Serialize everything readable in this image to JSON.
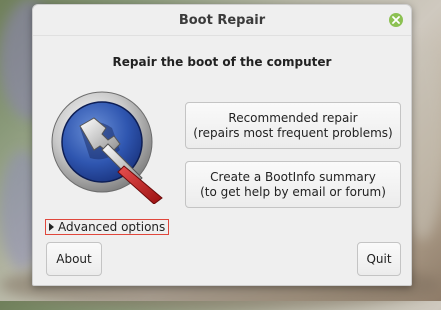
{
  "window": {
    "title": "Boot Repair"
  },
  "main": {
    "heading": "Repair the boot of the computer",
    "recommended_repair": {
      "line1": "Recommended repair",
      "line2": "(repairs most frequent problems)"
    },
    "bootinfo_summary": {
      "line1": "Create a BootInfo summary",
      "line2": "(to get help by email or forum)"
    },
    "advanced_options_label": "Advanced options"
  },
  "footer": {
    "about_label": "About",
    "quit_label": "Quit"
  },
  "icons": {
    "close": "close-icon",
    "logo": "boot-repair-logo-icon",
    "expander": "triangle-right-icon"
  },
  "colors": {
    "close_button": "#8cc152",
    "advanced_focus_border": "#e0473c",
    "window_bg": "#efefef"
  }
}
